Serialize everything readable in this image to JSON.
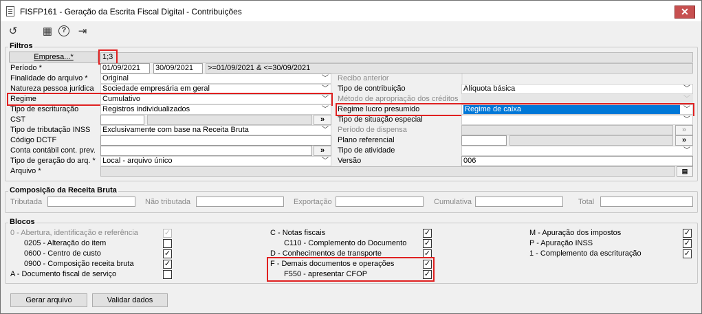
{
  "window": {
    "title": "FISFP161 - Geração da Escrita Fiscal Digital - Contribuições",
    "close": "✕"
  },
  "toolbar": {
    "undo": "↺",
    "calendar": "▦",
    "help": "?",
    "exit": "⇥"
  },
  "filtros": {
    "legend": "Filtros",
    "empresa_label": "Empresa...*",
    "empresa_value": "1;3",
    "periodo_label": "Período *",
    "periodo_start": "01/09/2021",
    "periodo_end": "30/09/2021",
    "periodo_expr": ">=01/09/2021 & <=30/09/2021",
    "finalidade_label": "Finalidade do arquivo *",
    "finalidade_value": "Original",
    "natureza_label": "Natureza pessoa jurídica",
    "natureza_value": "Sociedade empresária em geral",
    "regime_label": "Regime",
    "regime_value": "Cumulativo",
    "tipo_escrit_label": "Tipo de escrituração",
    "tipo_escrit_value": "Registros individualizados",
    "cst_label": "CST",
    "tipo_trib_label": "Tipo de tributação INSS",
    "tipo_trib_value": "Exclusivamente com base na Receita Bruta",
    "codigo_dctf_label": "Código DCTF",
    "conta_label": "Conta contábil cont. prev.",
    "tipo_geracao_label": "Tipo de geração do arq. *",
    "tipo_geracao_value": "Local - arquivo único",
    "arquivo_label": "Arquivo *",
    "recibo_label": "Recibo anterior",
    "tipo_contrib_label": "Tipo de contribuição",
    "tipo_contrib_value": "Alíquota básica",
    "metodo_label": "Método de apropriação dos créditos",
    "regime_lucro_label": "Regime lucro presumido",
    "regime_lucro_value": "Regime de caixa",
    "tipo_situacao_label": "Tipo de situação especial",
    "periodo_dispensa_label": "Período de dispensa",
    "plano_label": "Plano referencial",
    "tipo_atividade_label": "Tipo de atividade",
    "versao_label": "Versão",
    "versao_value": "006",
    "more_btn": "»"
  },
  "composicao": {
    "legend": "Composição da Receita Bruta",
    "tributada": "Tributada",
    "nao_tributada": "Não tributada",
    "exportacao": "Exportação",
    "cumulativa": "Cumulativa",
    "total": "Total"
  },
  "blocos": {
    "legend": "Blocos",
    "col1": [
      {
        "label": "0 - Abertura, identificação e referência",
        "checked": true,
        "disabled": true
      },
      {
        "label": "0205 - Alteração do item",
        "checked": false
      },
      {
        "label": "0600 - Centro de custo",
        "checked": true
      },
      {
        "label": "0900 - Composição receita bruta",
        "checked": true
      },
      {
        "label": "A - Documento fiscal de serviço",
        "checked": false
      }
    ],
    "col2": [
      {
        "label": "C - Notas fiscais",
        "checked": true
      },
      {
        "label": "C110 - Complemento do Documento",
        "checked": true
      },
      {
        "label": "D - Conhecimentos de transporte",
        "checked": true
      },
      {
        "label": "F - Demais documentos e operações",
        "checked": true
      },
      {
        "label": "F550 - apresentar CFOP",
        "checked": true
      }
    ],
    "col3": [
      {
        "label": "M - Apuração dos impostos",
        "checked": true
      },
      {
        "label": "P - Apuração INSS",
        "checked": true
      },
      {
        "label": "1 - Complemento da escrituração",
        "checked": true
      }
    ]
  },
  "buttons": {
    "gerar": "Gerar arquivo",
    "validar": "Validar dados"
  },
  "colors": {
    "highlight": "#0078d7",
    "annotation": "#e02020"
  }
}
